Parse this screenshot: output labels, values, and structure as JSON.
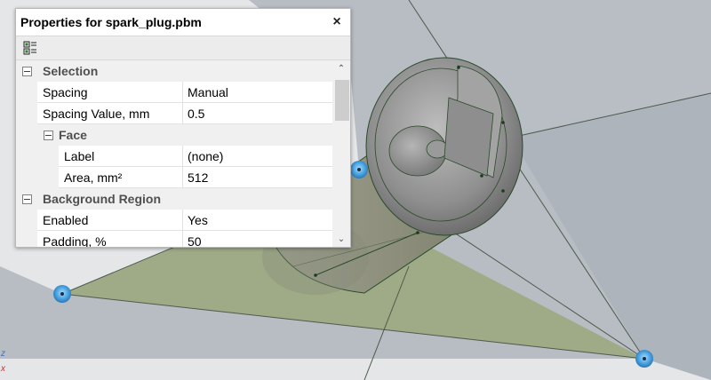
{
  "panel": {
    "title": "Properties for spark_plug.pbm",
    "close_glyph": "×",
    "toolbar_icon": "categorized-view-icon"
  },
  "grid": {
    "selection": {
      "label": "Selection",
      "spacing": {
        "name": "Spacing",
        "value": "Manual"
      },
      "spacing_value": {
        "name": "Spacing Value, mm",
        "value": "0.5"
      },
      "face": {
        "label": "Face",
        "label_prop": {
          "name": "Label",
          "value": "(none)"
        },
        "area": {
          "name": "Area, mm²",
          "value": "512"
        }
      }
    },
    "background_region": {
      "label": "Background Region",
      "enabled": {
        "name": "Enabled",
        "value": "Yes"
      },
      "padding": {
        "name": "Padding, %",
        "value": "50"
      }
    }
  },
  "scrollbar": {
    "up_glyph": "⌃",
    "down_glyph": "⌄"
  },
  "axes": {
    "z_label": "z",
    "x_label": "x"
  },
  "colors": {
    "viewport_bg": "#e4e6e8",
    "plane_gray": "#a9b1b8",
    "plane_green": "#9fab86",
    "model_gray": "#9a9a9a",
    "handle_blue": "#4aa3e0",
    "edge_dark": "#2a4a2a"
  }
}
